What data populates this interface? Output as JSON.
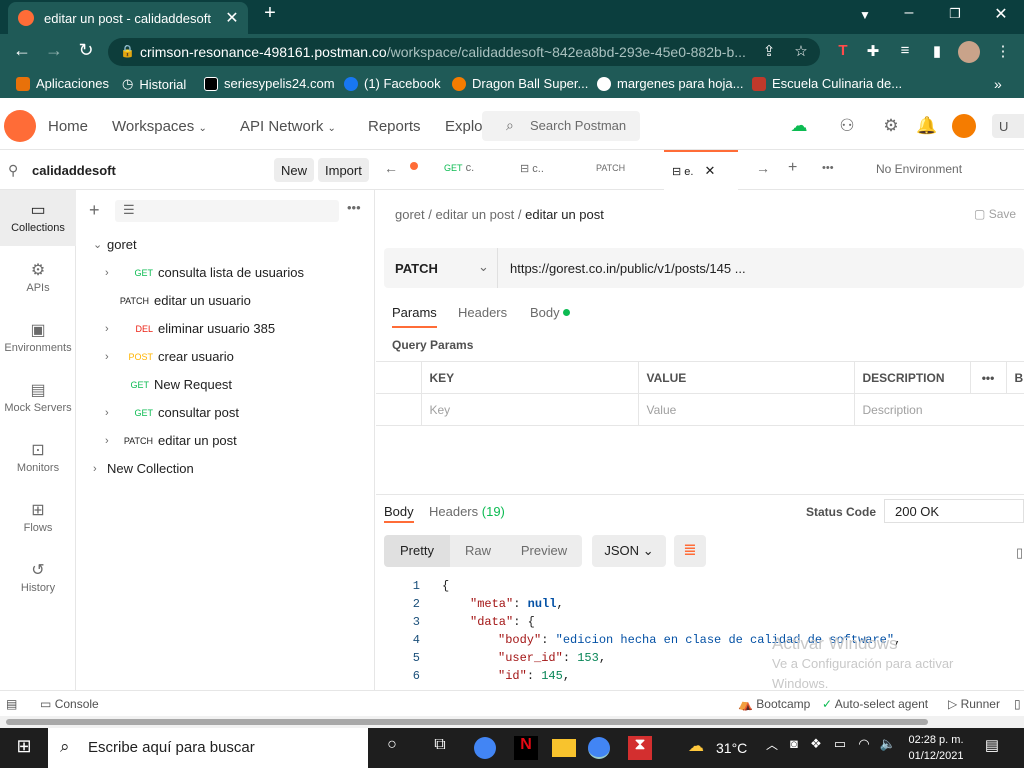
{
  "browser": {
    "tab_title": "editar un post - calidaddesoft",
    "url_host": "crimson-resonance-498161.postman.co",
    "url_path": "/workspace/calidaddesoft~842ea8bd-293e-45e0-882b-b..."
  },
  "bookmarks": [
    {
      "label": "Aplicaciones",
      "color": "#e8710a"
    },
    {
      "label": "Historial",
      "color": "#ffffff"
    },
    {
      "label": "seriesypelis24.com",
      "color": "#000000"
    },
    {
      "label": "(1) Facebook",
      "color": "#1877f2"
    },
    {
      "label": "Dragon Ball Super...",
      "color": "#f57c00"
    },
    {
      "label": "margenes para hoja...",
      "color": "#ffffff"
    },
    {
      "label": "Escuela Culinaria de...",
      "color": "#c0392b"
    }
  ],
  "topnav": {
    "home": "Home",
    "workspaces": "Workspaces",
    "api_network": "API Network",
    "reports": "Reports",
    "explore": "Explo",
    "search_placeholder": "Search Postman",
    "upgrade": "U"
  },
  "workspace": {
    "name": "calidaddesoft",
    "new_label": "New",
    "import_label": "Import"
  },
  "rail": [
    {
      "label": "Collections",
      "icon": "collections-icon",
      "glyph": "▭"
    },
    {
      "label": "APIs",
      "icon": "apis-icon",
      "glyph": "⚙"
    },
    {
      "label": "Environments",
      "icon": "environments-icon",
      "glyph": "▣"
    },
    {
      "label": "Mock Servers",
      "icon": "mock-servers-icon",
      "glyph": "▤"
    },
    {
      "label": "Monitors",
      "icon": "monitors-icon",
      "glyph": "⊡"
    },
    {
      "label": "Flows",
      "icon": "flows-icon",
      "glyph": "⊞"
    },
    {
      "label": "History",
      "icon": "history-icon",
      "glyph": "↺"
    }
  ],
  "collection": {
    "name": "goret",
    "items": [
      {
        "method": "GET",
        "label": "consulta lista de usuarios",
        "color": "#0cbb52",
        "folder": true
      },
      {
        "method": "PATCH",
        "label": "editar un usuario",
        "color": "#212121",
        "folder": false
      },
      {
        "method": "DEL",
        "label": "eliminar usuario 385",
        "color": "#eb2013",
        "folder": true
      },
      {
        "method": "POST",
        "label": "crear usuario",
        "color": "#ffb400",
        "folder": true
      },
      {
        "method": "GET",
        "label": "New Request",
        "color": "#0cbb52",
        "folder": false
      },
      {
        "method": "GET",
        "label": "consultar post",
        "color": "#0cbb52",
        "folder": true
      },
      {
        "method": "PATCH",
        "label": "editar un post",
        "color": "#212121",
        "folder": true
      }
    ],
    "other": "New Collection"
  },
  "tabs": [
    {
      "method": "GET",
      "label": "c."
    },
    {
      "method": "",
      "label": "c.."
    },
    {
      "method": "PATCH",
      "label": ""
    },
    {
      "method": "",
      "label": "e."
    }
  ],
  "environment": "No Environment",
  "breadcrumb": {
    "collection": "goret",
    "folder": "editar un post",
    "request": "editar un post",
    "save": "Save"
  },
  "request": {
    "method": "PATCH",
    "url": "https://gorest.co.in/public/v1/posts/145 ..."
  },
  "request_tabs": {
    "params": "Params",
    "headers": "Headers",
    "body": "Body"
  },
  "query_params": {
    "title": "Query Params",
    "columns": [
      "KEY",
      "VALUE",
      "DESCRIPTION"
    ],
    "bulk": "B",
    "placeholders": [
      "Key",
      "Value",
      "Description"
    ]
  },
  "response": {
    "body_tab": "Body",
    "headers_tab": "Headers",
    "headers_count": "(19)",
    "status_label": "Status Code",
    "status_value": "200 OK",
    "views": [
      "Pretty",
      "Raw",
      "Preview"
    ],
    "format": "JSON",
    "lines": [
      "1",
      "2",
      "3",
      "4",
      "5",
      "6"
    ]
  },
  "json_body": {
    "meta_key": "\"meta\"",
    "meta_val": "null",
    "data_key": "\"data\"",
    "body_key": "\"body\"",
    "body_val": "\"edicion hecha en clase de calidad de software\"",
    "user_key": "\"user_id\"",
    "user_val": "153",
    "id_key": "\"id\"",
    "id_val": "145"
  },
  "statusbar": {
    "console": "Console",
    "bootcamp": "Bootcamp",
    "agent": "Auto-select agent",
    "runner": "Runner"
  },
  "watermark": {
    "line1": "Activar Windows",
    "line2": "Ve a Configuración para activar",
    "line3": "Windows."
  },
  "taskbar": {
    "search": "Escribe aquí para buscar",
    "temp": "31°C",
    "time": "02:28 p. m.",
    "date": "01/12/2021"
  }
}
